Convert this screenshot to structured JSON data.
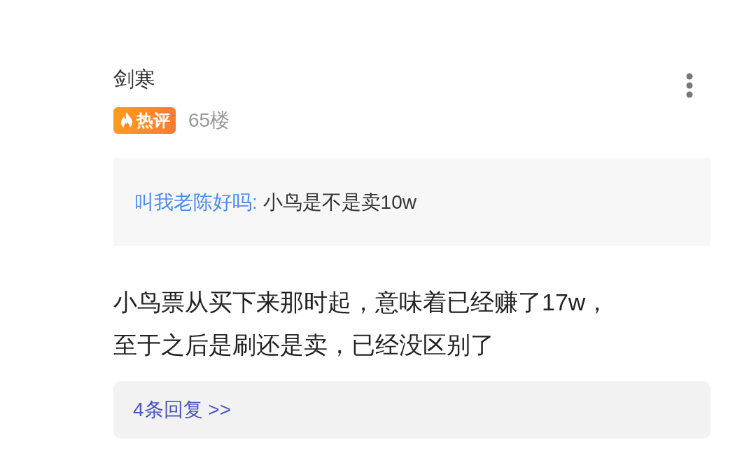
{
  "comment": {
    "username": "剑寒",
    "badge": "热评",
    "floor": "65楼",
    "quote": {
      "author": "叫我老陈好吗:",
      "text": "小鸟是不是卖10w"
    },
    "body": "小鸟票从买下来那时起，意味着已经赚了17w，至于之后是刷还是卖，已经没区别了",
    "replies_link": "4条回复 >>"
  }
}
